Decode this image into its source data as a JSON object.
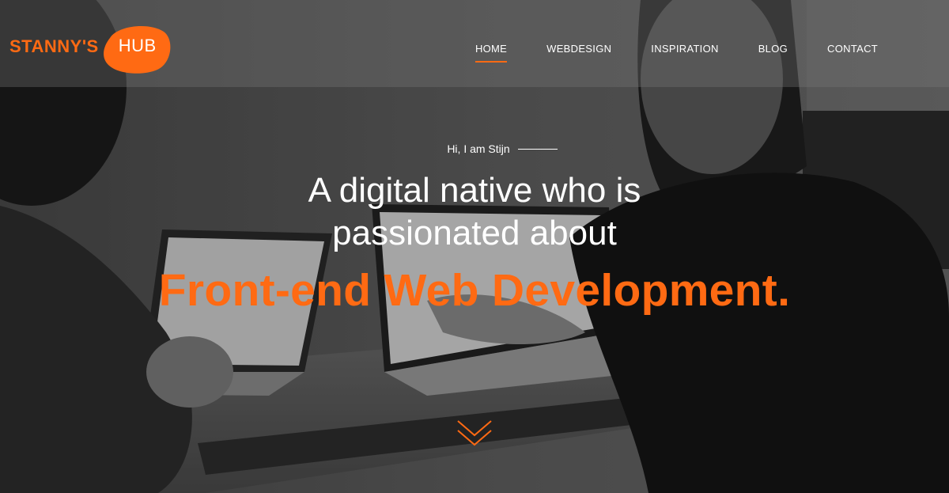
{
  "header": {
    "logo": {
      "word": "STANNY'S",
      "badge": "HUB"
    },
    "nav": [
      {
        "label": "HOME",
        "active": true
      },
      {
        "label": "WEBDESIGN",
        "active": false
      },
      {
        "label": "INSPIRATION",
        "active": false
      },
      {
        "label": "BLOG",
        "active": false
      },
      {
        "label": "CONTACT",
        "active": false
      }
    ]
  },
  "hero": {
    "greeting": "Hi, I am Stijn",
    "headline_line1": "A digital native who is",
    "headline_line2": "passionated about",
    "focus": "Front-end Web Development.",
    "scroll_icon": "chevron-double-down-icon"
  },
  "colors": {
    "accent": "#ff6a13",
    "text": "#ffffff",
    "overlay": "#3a3a3a"
  }
}
